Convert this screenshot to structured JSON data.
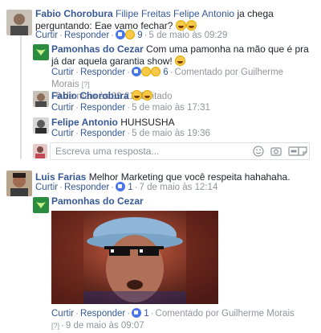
{
  "colors": {
    "link": "#365899",
    "meta": "#90949c",
    "brand_green": "#2a8c3e",
    "like_blue": "#4a76e8"
  },
  "thread1": {
    "comment": {
      "author": "Fabio Chorobura",
      "mention1": "Filipe Freitas",
      "mention2": "Felipe Antonio",
      "text": "ja chega perguntando: Eae vamo fechar?",
      "like": "Curtir",
      "reply": "Responder",
      "reaction_count": "9",
      "date": "5 de maio às 09:29"
    },
    "reply1": {
      "author": "Pamonhas do Cezar",
      "text": "Com uma pamonha na mão que é pra já dar aquela garantia show!",
      "like": "Curtir",
      "reply": "Responder",
      "reaction_count": "6",
      "commented_by": "Comentado por Guilherme Morais",
      "help_mark": "[?]",
      "date": "9 de maio às 09:21",
      "edited": "Editado"
    },
    "reply2": {
      "author": "Fabio Chorobura",
      "like": "Curtir",
      "reply": "Responder",
      "date": "5 de maio às 17:31"
    },
    "reply3": {
      "author": "Felipe Antonio",
      "text": "HUHSUSHA",
      "like": "Curtir",
      "reply": "Responder",
      "date": "5 de maio às 19:36"
    },
    "reply_input": {
      "placeholder": "Escreva uma resposta..."
    }
  },
  "thread2": {
    "comment": {
      "author": "Luis Farias",
      "text": "Melhor Marketing que você respeita hahahaha.",
      "like": "Curtir",
      "reply": "Responder",
      "reaction_count": "1",
      "date": "7 de maio às 12:14"
    },
    "reply1": {
      "author": "Pamonhas do Cezar",
      "like": "Curtir",
      "reply": "Responder",
      "reaction_count": "1",
      "commented_by": "Comentado por Guilherme Morais",
      "help_mark": "[?]",
      "date": "9 de maio às 09:07"
    }
  },
  "icons": [
    "like-reaction-icon",
    "haha-reaction-icon",
    "wow-reaction-icon",
    "emoji-picker-icon",
    "camera-icon",
    "gif-icon",
    "sticker-icon"
  ]
}
